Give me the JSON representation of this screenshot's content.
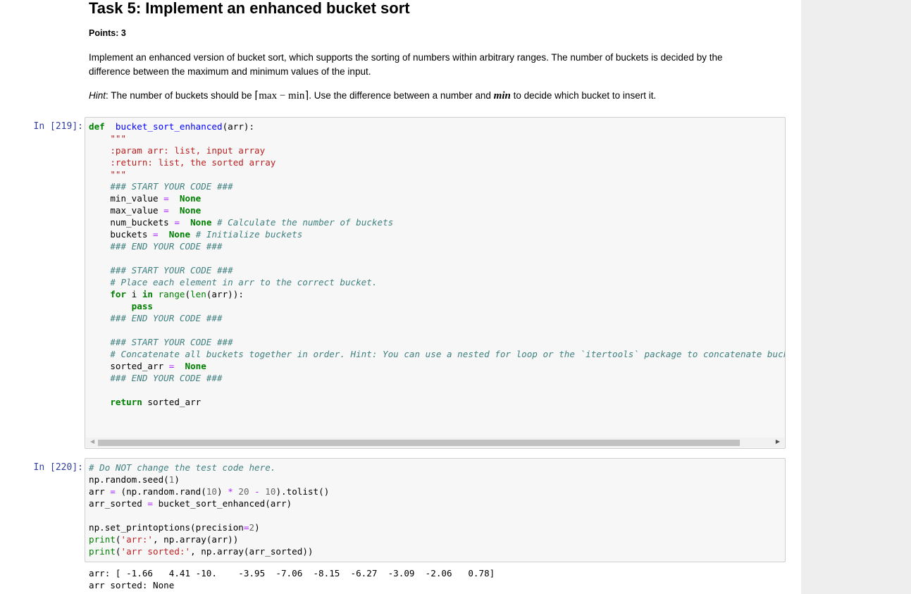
{
  "markdown": {
    "title": "Task 5: Implement an enhanced bucket sort",
    "points": "Points: 3",
    "description": "Implement an enhanced version of bucket sort, which supports the sorting of numbers within arbitrary ranges. The number of buckets is decided by the difference between the maximum and minimum values of the input.",
    "hint_label": "Hint",
    "hint_prefix": ": The number of buckets should be ",
    "hint_math": "⌈max − min⌉",
    "hint_middle": ". Use the difference between a number and ",
    "hint_min": "min",
    "hint_suffix": " to decide which bucket to insert it."
  },
  "cells": [
    {
      "prompt": "In [219]:",
      "lines": [
        [
          [
            "kw",
            "def"
          ],
          [
            "",
            "  "
          ],
          [
            "fn",
            "bucket_sort_enhanced"
          ],
          [
            "",
            "(arr):"
          ]
        ],
        [
          [
            "str",
            "    \"\"\""
          ]
        ],
        [
          [
            "str",
            "    :param arr: list, input array"
          ]
        ],
        [
          [
            "str",
            "    :return: list, the sorted array"
          ]
        ],
        [
          [
            "str",
            "    \"\"\""
          ]
        ],
        [
          [
            "cm",
            "    ### START YOUR CODE ###"
          ]
        ],
        [
          [
            "",
            "    min_value "
          ],
          [
            "op",
            "="
          ],
          [
            "",
            "  "
          ],
          [
            "const",
            "None"
          ]
        ],
        [
          [
            "",
            "    max_value "
          ],
          [
            "op",
            "="
          ],
          [
            "",
            "  "
          ],
          [
            "const",
            "None"
          ]
        ],
        [
          [
            "",
            "    num_buckets "
          ],
          [
            "op",
            "="
          ],
          [
            "",
            "  "
          ],
          [
            "const",
            "None"
          ],
          [
            "",
            ""
          ],
          [
            "cm",
            " # Calculate the number of buckets"
          ]
        ],
        [
          [
            "",
            "    buckets "
          ],
          [
            "op",
            "="
          ],
          [
            "",
            "  "
          ],
          [
            "const",
            "None"
          ],
          [
            "cm",
            " # Initialize buckets"
          ]
        ],
        [
          [
            "cm",
            "    ### END YOUR CODE ###"
          ]
        ],
        [
          [
            "",
            ""
          ]
        ],
        [
          [
            "cm",
            "    ### START YOUR CODE ###"
          ]
        ],
        [
          [
            "cm",
            "    # Place each element in arr to the correct bucket."
          ]
        ],
        [
          [
            "kw",
            "    for"
          ],
          [
            "",
            " i "
          ],
          [
            "kw",
            "in"
          ],
          [
            "",
            ""
          ],
          [
            "bi",
            " range"
          ],
          [
            "",
            "("
          ],
          [
            "bi",
            "len"
          ],
          [
            "",
            "(arr)):"
          ]
        ],
        [
          [
            "kw",
            "        pass"
          ]
        ],
        [
          [
            "cm",
            "    ### END YOUR CODE ###"
          ]
        ],
        [
          [
            "",
            ""
          ]
        ],
        [
          [
            "cm",
            "    ### START YOUR CODE ###"
          ]
        ],
        [
          [
            "cm",
            "    # Concatenate all buckets together in order. Hint: You can use a nested for loop or the `itertools` package to concatenate buckets."
          ]
        ],
        [
          [
            "",
            "    sorted_arr "
          ],
          [
            "op",
            "="
          ],
          [
            "",
            "  "
          ],
          [
            "const",
            "None"
          ]
        ],
        [
          [
            "cm",
            "    ### END YOUR CODE ###"
          ]
        ],
        [
          [
            "",
            ""
          ]
        ],
        [
          [
            "kw",
            "    return"
          ],
          [
            "",
            " sorted_arr"
          ]
        ]
      ]
    },
    {
      "prompt": "In [220]:",
      "lines": [
        [
          [
            "cm",
            "# Do NOT change the test code here."
          ]
        ],
        [
          [
            "",
            "np.random.seed("
          ],
          [
            "nm",
            "1"
          ],
          [
            "",
            ")"
          ]
        ],
        [
          [
            "",
            "arr "
          ],
          [
            "op",
            "="
          ],
          [
            "",
            " (np.random.rand("
          ],
          [
            "nm",
            "10"
          ],
          [
            "",
            ") "
          ],
          [
            "op",
            "*"
          ],
          [
            "",
            ""
          ],
          [
            "nm",
            " 20"
          ],
          [
            "",
            ""
          ],
          [
            "op",
            " -"
          ],
          [
            "",
            ""
          ],
          [
            "nm",
            " 10"
          ],
          [
            "",
            ").tolist()"
          ]
        ],
        [
          [
            "",
            "arr_sorted "
          ],
          [
            "op",
            "="
          ],
          [
            "",
            " bucket_sort_enhanced(arr)"
          ]
        ],
        [
          [
            "",
            ""
          ]
        ],
        [
          [
            "",
            "np.set_printoptions(precision"
          ],
          [
            "op",
            "="
          ],
          [
            "nm",
            "2"
          ],
          [
            "",
            ")"
          ]
        ],
        [
          [
            "bi",
            "print"
          ],
          [
            "",
            "("
          ],
          [
            "str",
            "'arr:'"
          ],
          [
            "",
            ", np.array(arr))"
          ]
        ],
        [
          [
            "bi",
            "print"
          ],
          [
            "",
            "("
          ],
          [
            "str",
            "'arr sorted:'"
          ],
          [
            "",
            ", np.array(arr_sorted))"
          ]
        ]
      ]
    }
  ],
  "output": {
    "lines": [
      "arr: [ -1.66   4.41 -10.    -3.95  -7.06  -8.15  -6.27  -3.09  -2.06   0.78]",
      "arr sorted: None"
    ]
  }
}
